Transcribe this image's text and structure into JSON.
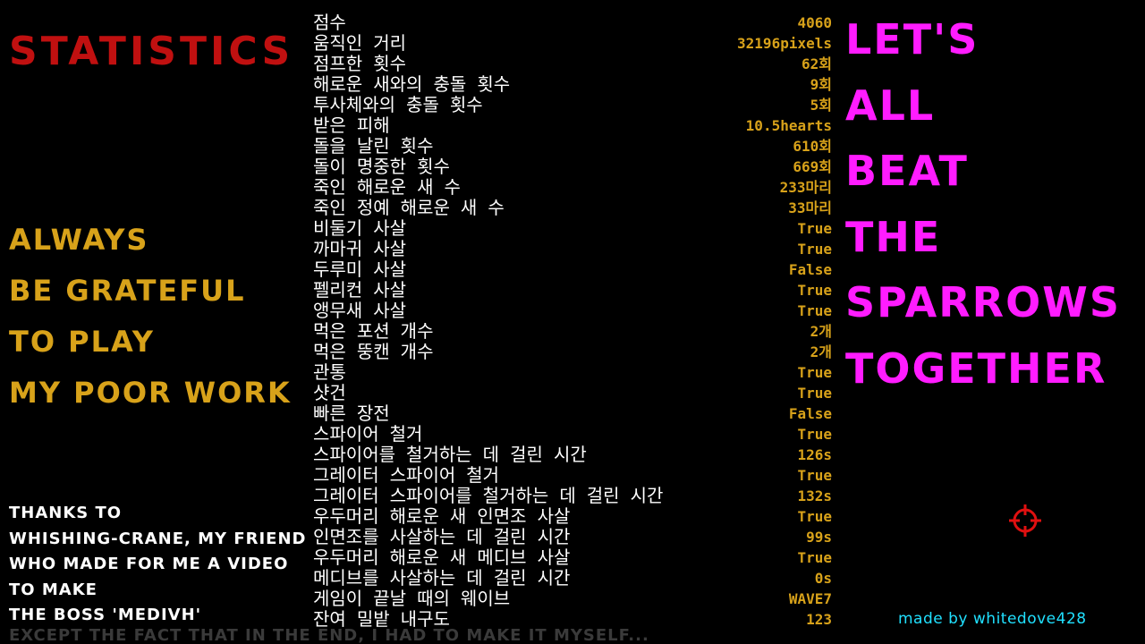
{
  "left_panel": {
    "title": "STATISTICS",
    "grateful_lines": [
      "ALWAYS",
      "BE GRATEFUL",
      "TO PLAY",
      "MY POOR WORK"
    ],
    "thanks_lines": [
      "THANKS TO",
      "WHISHING-CRANE, MY FRIEND",
      "WHO MADE FOR ME A VIDEO",
      "TO MAKE",
      "THE BOSS 'MEDIVH'"
    ],
    "thanks_faded": "EXCEPT THE FACT THAT IN THE END, I HAD TO MAKE IT MYSELF..."
  },
  "stats": [
    {
      "label": "점수",
      "value": "4060"
    },
    {
      "label": "움직인 거리",
      "value": "32196pixels"
    },
    {
      "label": "점프한 횟수",
      "value": "62회"
    },
    {
      "label": "해로운 새와의 충돌 횟수",
      "value": "9회"
    },
    {
      "label": "투사체와의 충돌 횟수",
      "value": "5회"
    },
    {
      "label": "받은 피해",
      "value": "10.5hearts"
    },
    {
      "label": "돌을 날린 횟수",
      "value": "610회"
    },
    {
      "label": "돌이 명중한 횟수",
      "value": "669회"
    },
    {
      "label": "죽인 해로운 새 수",
      "value": "233마리"
    },
    {
      "label": "죽인 정예 해로운 새 수",
      "value": "33마리"
    },
    {
      "label": "비둘기 사살",
      "value": "True"
    },
    {
      "label": "까마귀 사살",
      "value": "True"
    },
    {
      "label": "두루미 사살",
      "value": "False"
    },
    {
      "label": "펠리컨 사살",
      "value": "True"
    },
    {
      "label": "앵무새 사살",
      "value": "True"
    },
    {
      "label": "먹은 포션 개수",
      "value": "2개"
    },
    {
      "label": "먹은 뚱캔 개수",
      "value": "2개"
    },
    {
      "label": "관통",
      "value": "True"
    },
    {
      "label": "샷건",
      "value": "True"
    },
    {
      "label": "빠른 장전",
      "value": "False"
    },
    {
      "label": "스파이어 철거",
      "value": "True"
    },
    {
      "label": "스파이어를 철거하는 데 걸린 시간",
      "value": "126s"
    },
    {
      "label": "그레이터 스파이어 철거",
      "value": "True"
    },
    {
      "label": "그레이터 스파이어를 철거하는 데 걸린 시간",
      "value": "132s"
    },
    {
      "label": "우두머리 해로운 새 인면조 사살",
      "value": "True"
    },
    {
      "label": "인면조를 사살하는 데 걸린 시간",
      "value": "99s"
    },
    {
      "label": "우두머리 해로운 새 메디브 사살",
      "value": "True"
    },
    {
      "label": "메디브를 사살하는 데 걸린 시간",
      "value": "0s"
    },
    {
      "label": "게임이 끝날 때의 웨이브",
      "value": "WAVE7"
    },
    {
      "label": "잔여 밀밭 내구도",
      "value": "123"
    }
  ],
  "right_panel": {
    "slogan_lines": [
      "LET'S",
      "ALL",
      "BEAT",
      "THE",
      "SPARROWS",
      "TOGETHER"
    ],
    "credit": "made by whitedove428",
    "crosshair_icon": "crosshair-icon"
  },
  "colors": {
    "background": "#000000",
    "title_red": "#c01010",
    "gold": "#d8a21a",
    "magenta": "#ff1cff",
    "cyan": "#20e0ff",
    "crosshair_red": "#e01010"
  }
}
